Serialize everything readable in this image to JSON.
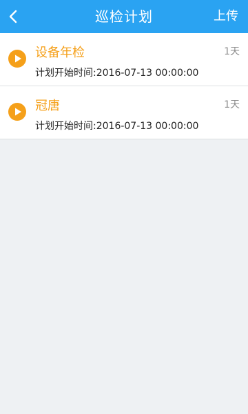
{
  "header": {
    "title": "巡检计划",
    "upload_label": "上传"
  },
  "plans": [
    {
      "name": "设备年检",
      "start_time": "计划开始时间:2016-07-13 00:00:00",
      "duration": "1天"
    },
    {
      "name": "冠唐",
      "start_time": "计划开始时间:2016-07-13 00:00:00",
      "duration": "1天"
    }
  ],
  "colors": {
    "header_bg": "#2aa3f2",
    "accent_orange": "#f5a01a",
    "background": "#eef1f3"
  },
  "icons": {
    "back": "chevron-left-icon",
    "play": "play-icon"
  }
}
